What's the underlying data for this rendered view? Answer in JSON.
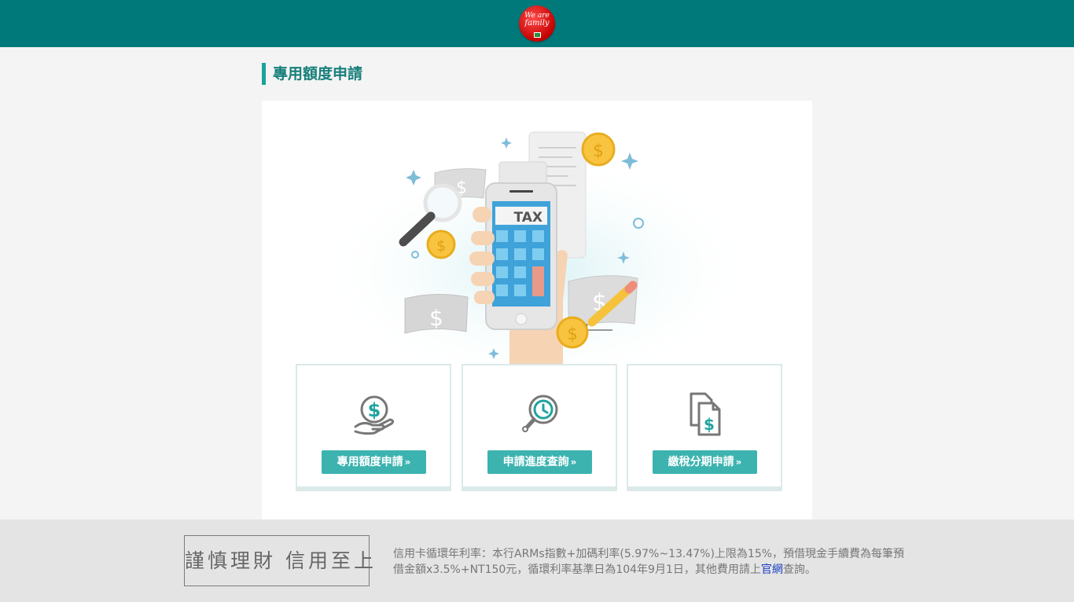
{
  "header": {
    "logo_line1": "We are",
    "logo_line2": "family",
    "accent_color": "#00797a"
  },
  "page": {
    "title": "專用額度申請"
  },
  "hero": {
    "calculator_screen_text": "TAX",
    "currency_symbol": "$"
  },
  "tiles": [
    {
      "icon": "hand-coin-icon",
      "label": "專用額度申請",
      "chevron": "»"
    },
    {
      "icon": "clock-search-icon",
      "label": "申請進度查詢",
      "chevron": "»"
    },
    {
      "icon": "documents-dollar-icon",
      "label": "繳稅分期申請",
      "chevron": "»"
    }
  ],
  "footer": {
    "slogan": "謹慎理財 信用至上",
    "note_part1": "信用卡循環年利率：本行ARMs指數+加碼利率(5.97%~13.47%)上限為15%，預借現金手續費為每筆預借金額x3.5%+NT150元，循環利率基準日為104年9月1日，其他費用請上",
    "note_link": "官網",
    "note_part2": "查詢。"
  }
}
